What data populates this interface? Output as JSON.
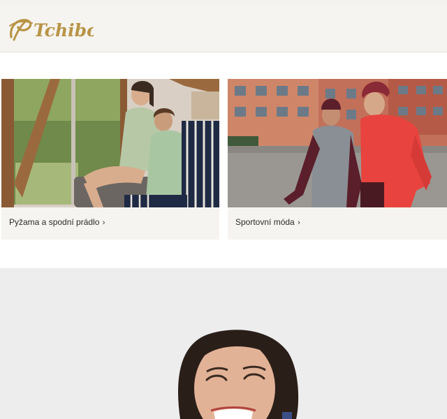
{
  "header": {
    "logo_text": "Tchibo",
    "brand_color": "#b89446"
  },
  "categories": [
    {
      "label": "Pyžama a spodní prádlo",
      "chevron": "›",
      "image": "people-in-sleepwear-photo"
    },
    {
      "label": "Sportovní móda",
      "chevron": "›",
      "image": "people-in-sportswear-photo"
    }
  ],
  "hero": {
    "image": "smiling-woman-photo",
    "background_color": "#ededed"
  }
}
